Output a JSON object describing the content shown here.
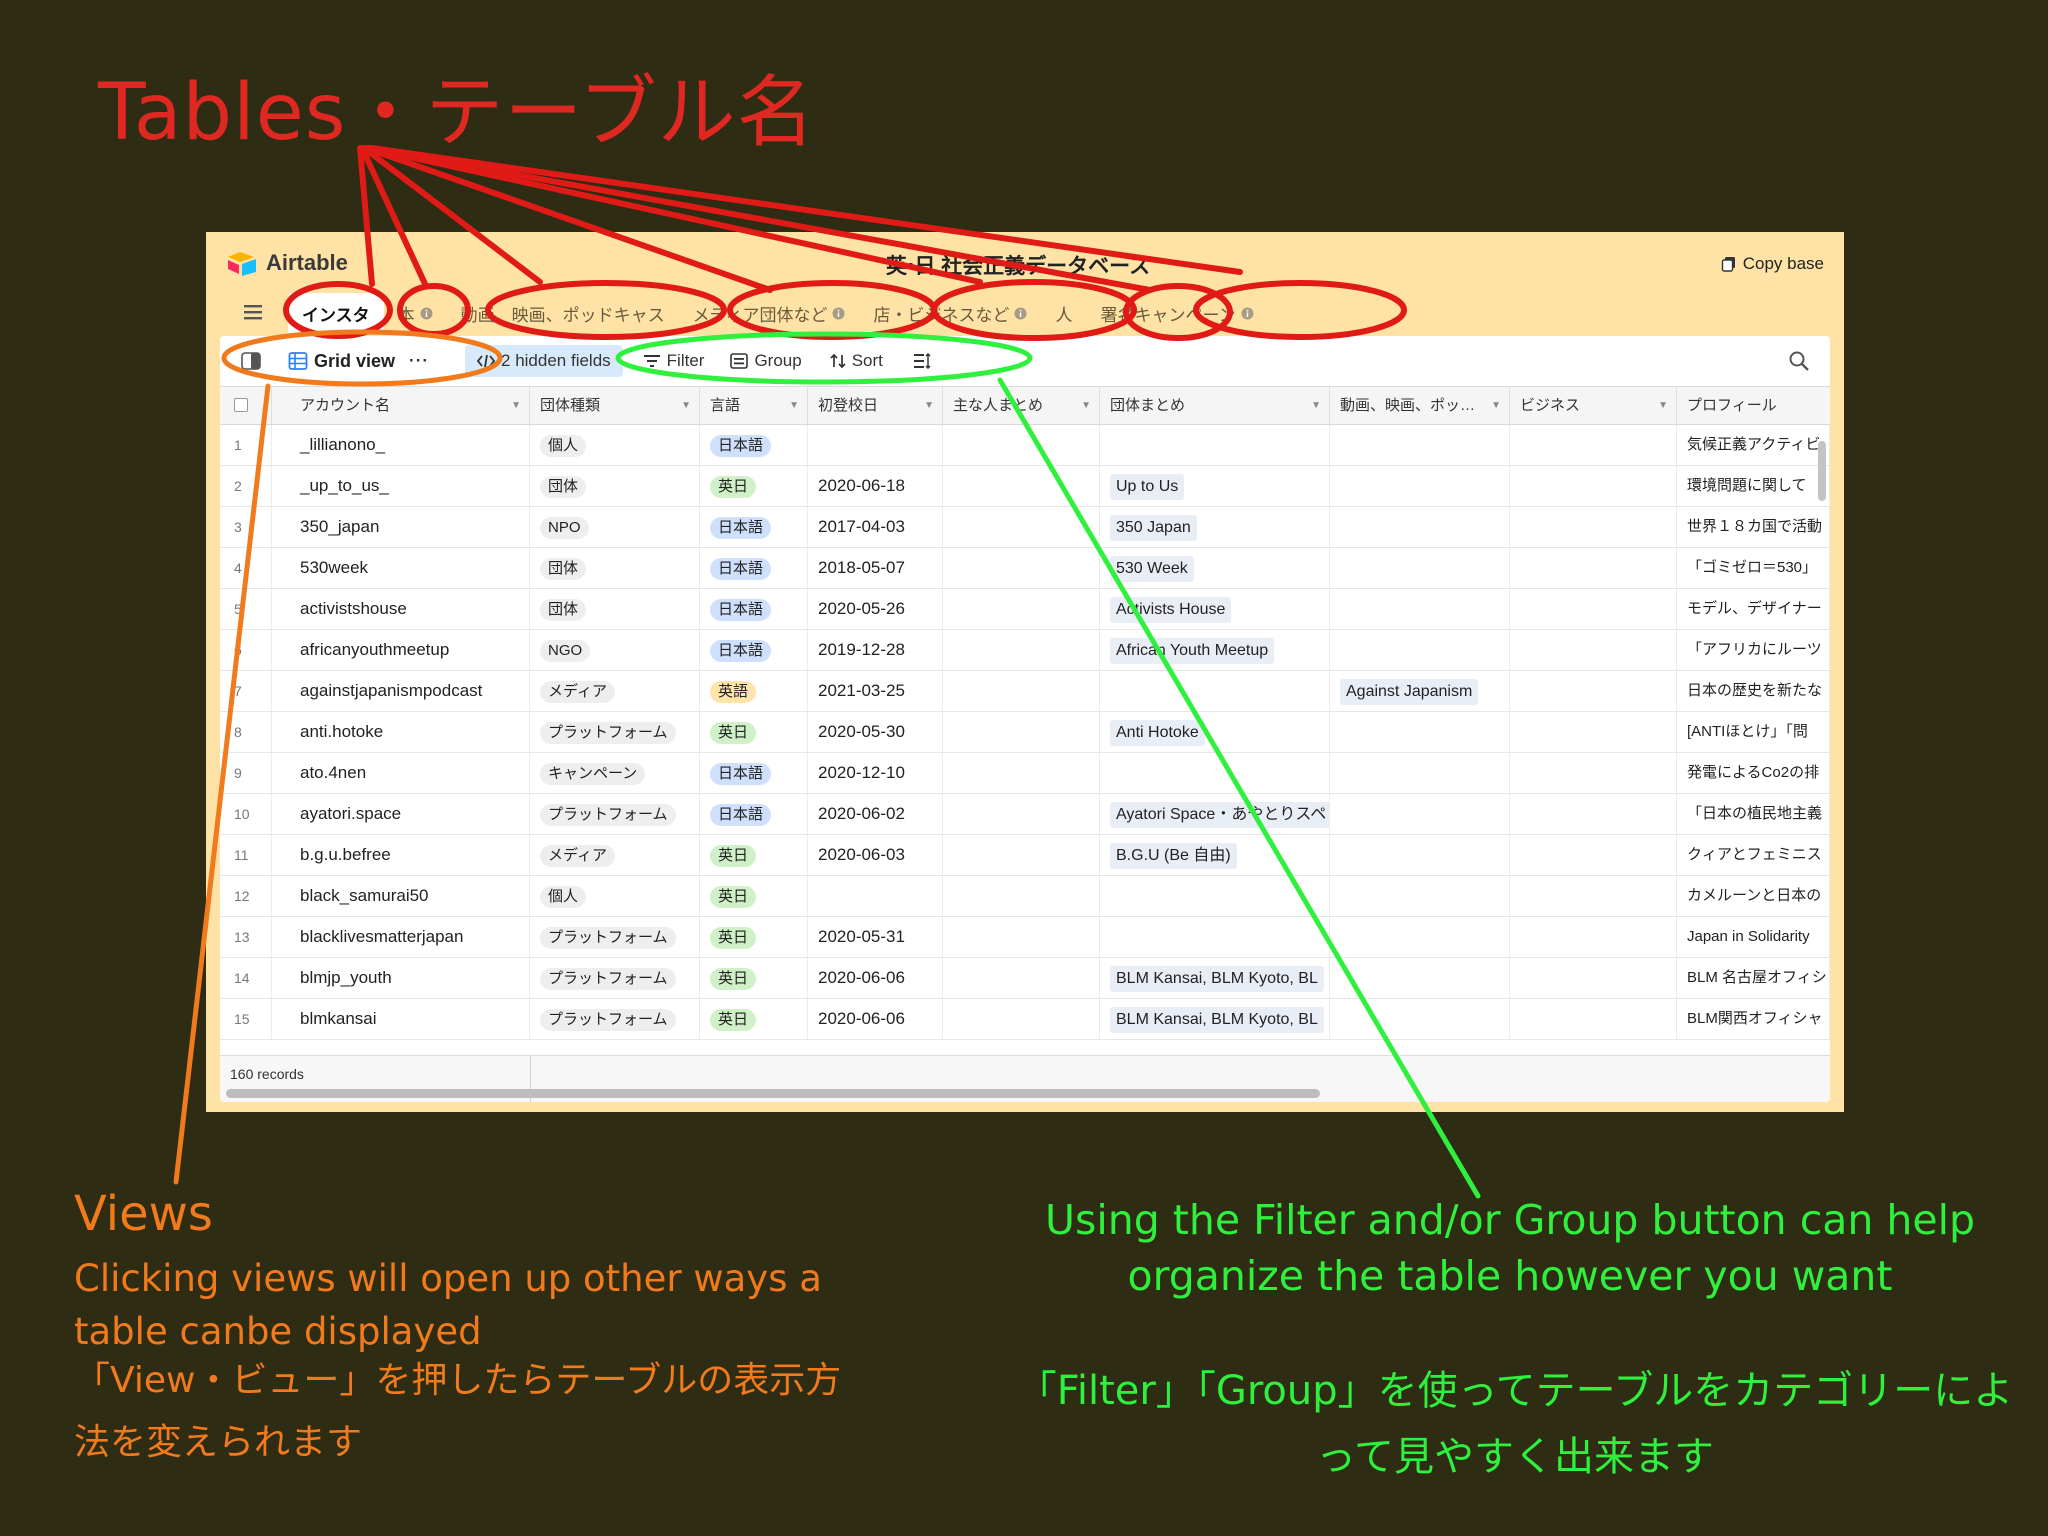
{
  "annotations": {
    "tables_title": "Tables・テーブル名",
    "views_title": "Views",
    "views_desc_en": "Clicking views will open up other ways a table canbe displayed",
    "views_desc_jp": "「View・ビュー」を押したらテーブルの表示方法を変えられます",
    "filter_desc_en": "Using the Filter and/or Group button can help organize the table however you want",
    "filter_desc_jp": "「Filter」「Group」を使ってテーブルをカテゴリーによって見やすく出来ます",
    "colors": {
      "tables": "#e02822",
      "views": "#f07a1c",
      "filter": "#2ff03c"
    }
  },
  "app": {
    "logo_text": "Airtable",
    "base_name": "英•日 社会正義データベース",
    "copy_base_label": "Copy base",
    "tabs": [
      {
        "label": "インスタ",
        "active": true
      },
      {
        "label": "本",
        "info": true
      },
      {
        "label": "動画、映画、ポッドキャス"
      },
      {
        "label": "メディア団体など",
        "info": true
      },
      {
        "label": "店・ビジネスなど",
        "info": true
      },
      {
        "label": "人"
      },
      {
        "label": "署名キャンペーン",
        "info": true
      }
    ]
  },
  "viewbar": {
    "view_name": "Grid view",
    "more": "···",
    "hidden_fields": "2 hidden fields",
    "filter": "Filter",
    "group": "Group",
    "sort": "Sort",
    "icons": [
      "sidebar-toggle-icon",
      "grid-view-icon",
      "code-icon",
      "filter-icon",
      "group-icon",
      "sort-icon",
      "row-height-icon",
      "search-icon"
    ]
  },
  "columns": [
    "アカウント名",
    "団体種類",
    "言語",
    "初登校日",
    "主な人まとめ",
    "団体まとめ",
    "動画、映画、ポッ…",
    "ビジネス",
    "プロフィール"
  ],
  "rows": [
    {
      "num": "1",
      "account": "_lillianono_",
      "type": "個人",
      "lang": "日本語",
      "date": "",
      "group": "",
      "media": "",
      "profile": "気候正義アクティビ"
    },
    {
      "num": "2",
      "account": "_up_to_us_",
      "type": "団体",
      "lang": "英日",
      "date": "2020-06-18",
      "group": "Up to Us",
      "media": "",
      "profile": "環境問題に関して"
    },
    {
      "num": "3",
      "account": "350_japan",
      "type": "NPO",
      "lang": "日本語",
      "date": "2017-04-03",
      "group": "350 Japan",
      "media": "",
      "profile": "世界１８カ国で活動"
    },
    {
      "num": "4",
      "account": "530week",
      "type": "団体",
      "lang": "日本語",
      "date": "2018-05-07",
      "group": "530 Week",
      "media": "",
      "profile": "「ゴミゼロ＝530」"
    },
    {
      "num": "5",
      "account": "activistshouse",
      "type": "団体",
      "lang": "日本語",
      "date": "2020-05-26",
      "group": "Activists House",
      "media": "",
      "profile": "モデル、デザイナー"
    },
    {
      "num": "6",
      "account": "africanyouthmeetup",
      "type": "NGO",
      "lang": "日本語",
      "date": "2019-12-28",
      "group": "African Youth Meetup",
      "media": "",
      "profile": "「アフリカにルーツ"
    },
    {
      "num": "7",
      "account": "againstjapanismpodcast",
      "type": "メディア",
      "lang": "英語",
      "date": "2021-03-25",
      "group": "",
      "media": "Against Japanism",
      "profile": "日本の歴史を新たな"
    },
    {
      "num": "8",
      "account": "anti.hotoke",
      "type": "プラットフォーム",
      "lang": "英日",
      "date": "2020-05-30",
      "group": "Anti Hotoke",
      "media": "",
      "profile": "[ANTIほとけ」「問"
    },
    {
      "num": "9",
      "account": "ato.4nen",
      "type": "キャンペーン",
      "lang": "日本語",
      "date": "2020-12-10",
      "group": "",
      "media": "",
      "profile": "発電によるCo2の排"
    },
    {
      "num": "10",
      "account": "ayatori.space",
      "type": "プラットフォーム",
      "lang": "日本語",
      "date": "2020-06-02",
      "group": "Ayatori Space・あやとりスペ",
      "media": "",
      "profile": "「日本の植民地主義"
    },
    {
      "num": "11",
      "account": "b.g.u.befree",
      "type": "メディア",
      "lang": "英日",
      "date": "2020-06-03",
      "group": "B.G.U (Be 自由)",
      "media": "",
      "profile": "クィアとフェミニス"
    },
    {
      "num": "12",
      "account": "black_samurai50",
      "type": "個人",
      "lang": "英日",
      "date": "",
      "group": "",
      "media": "",
      "profile": "カメルーンと日本の"
    },
    {
      "num": "13",
      "account": "blacklivesmatterjapan",
      "type": "プラットフォーム",
      "lang": "英日",
      "date": "2020-05-31",
      "group": "",
      "media": "",
      "profile": "Japan in Solidarity"
    },
    {
      "num": "14",
      "account": "blmjp_youth",
      "type": "プラットフォーム",
      "lang": "英日",
      "date": "2020-06-06",
      "group": "BLM Kansai, BLM Kyoto, BL",
      "media": "",
      "profile": "BLM 名古屋オフィシ"
    },
    {
      "num": "15",
      "account": "blmkansai",
      "type": "プラットフォーム",
      "lang": "英日",
      "date": "2020-06-06",
      "group": "BLM Kansai, BLM Kyoto, BL",
      "media": "",
      "profile": "BLM関西オフィシャ"
    }
  ],
  "footer": {
    "records": "160 records"
  }
}
